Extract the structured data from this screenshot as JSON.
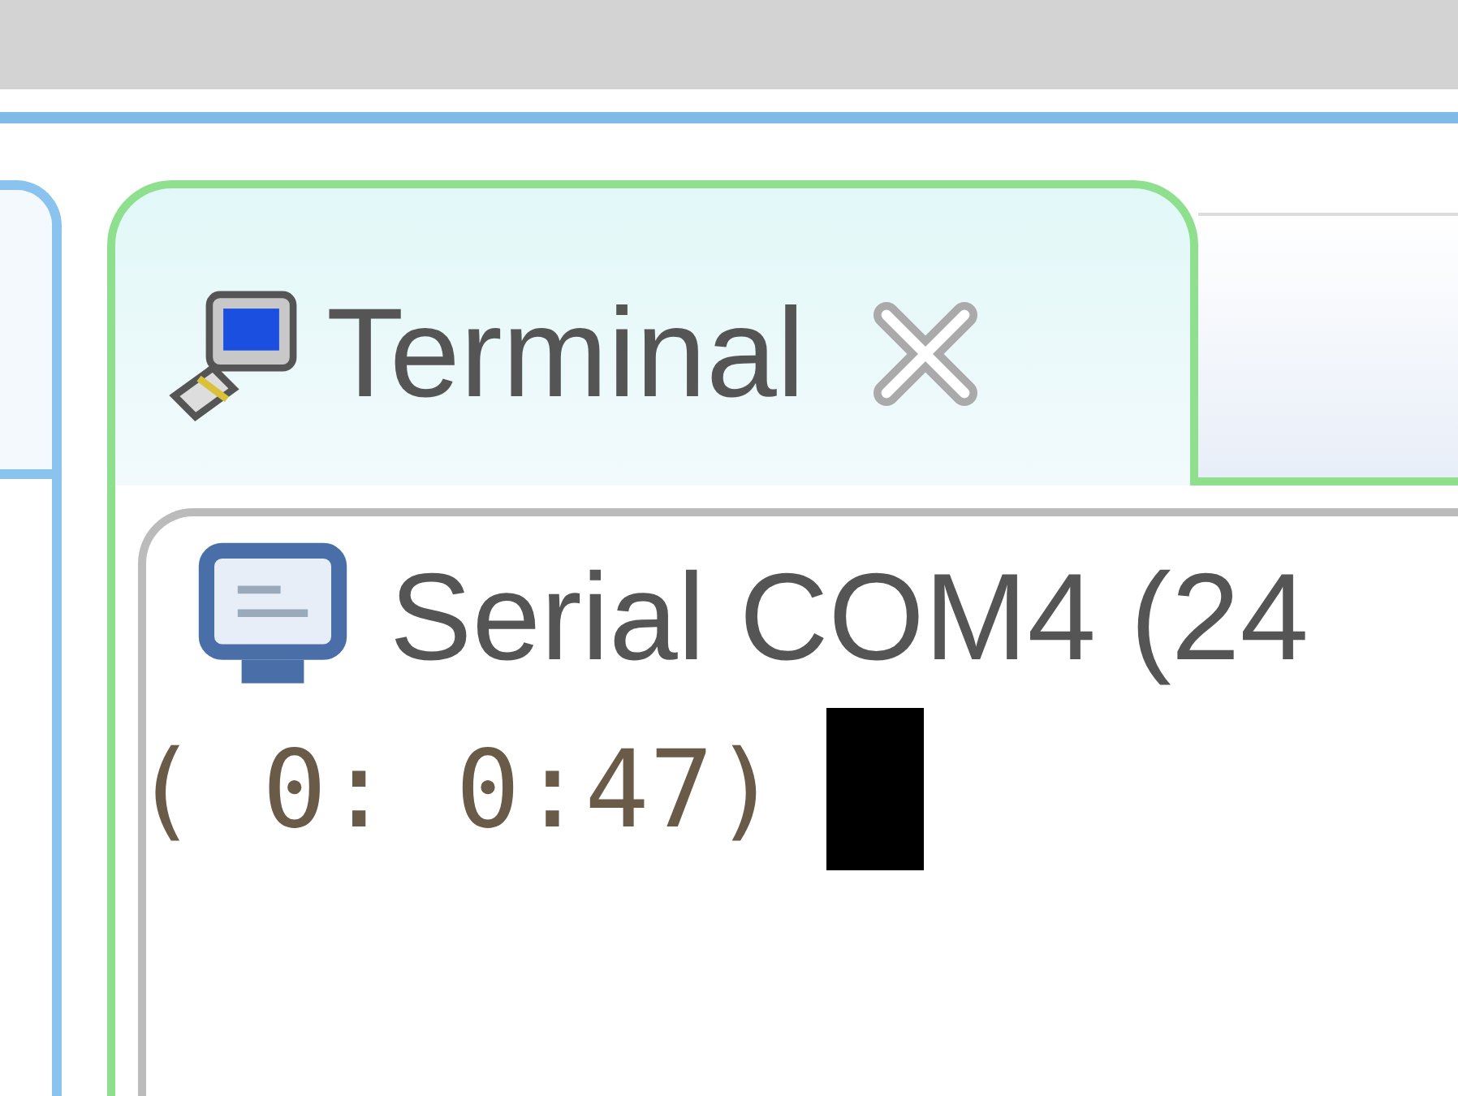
{
  "tab": {
    "label": "Terminal",
    "selected": true
  },
  "session": {
    "title": "Serial COM4 (24"
  },
  "terminal": {
    "lines": [
      "( 0: 0:47)"
    ],
    "cursor": true
  }
}
